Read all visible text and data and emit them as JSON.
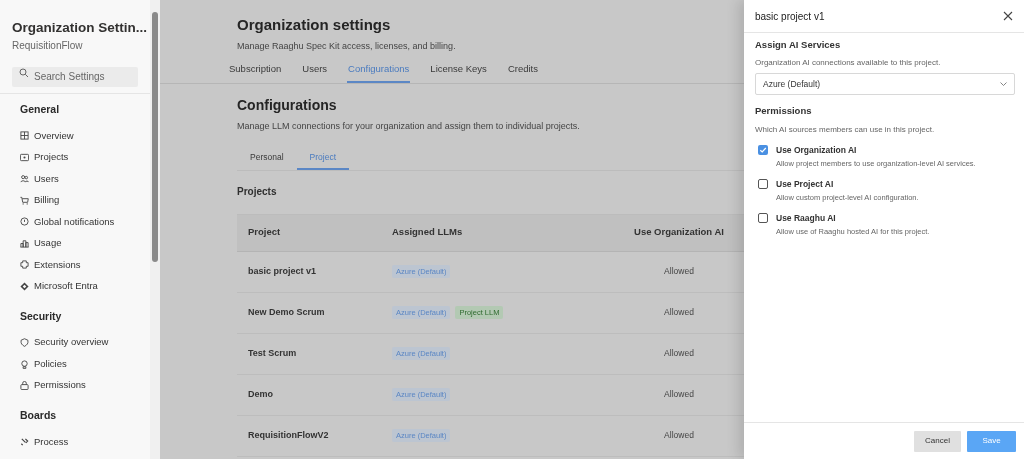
{
  "sidebar": {
    "title": "Organization Settin...",
    "subtitle": "RequisitionFlow",
    "search": {
      "placeholder": "Search Settings"
    },
    "sections": [
      {
        "heading": "General",
        "items": [
          {
            "label": "Overview"
          },
          {
            "label": "Projects"
          },
          {
            "label": "Users"
          },
          {
            "label": "Billing"
          },
          {
            "label": "Global notifications"
          },
          {
            "label": "Usage"
          },
          {
            "label": "Extensions"
          },
          {
            "label": "Microsoft Entra"
          }
        ]
      },
      {
        "heading": "Security",
        "items": [
          {
            "label": "Security overview"
          },
          {
            "label": "Policies"
          },
          {
            "label": "Permissions"
          }
        ]
      },
      {
        "heading": "Boards",
        "items": [
          {
            "label": "Process"
          }
        ]
      }
    ]
  },
  "main": {
    "title": "Organization settings",
    "subtitle": "Manage Raaghu Spec Kit access, licenses, and billing.",
    "tabs": [
      {
        "label": "Subscription",
        "selected": false
      },
      {
        "label": "Users",
        "selected": false
      },
      {
        "label": "Configurations",
        "selected": true
      },
      {
        "label": "License Keys",
        "selected": false
      },
      {
        "label": "Credits",
        "selected": false
      }
    ],
    "section_title": "Configurations",
    "section_subtitle": "Manage LLM connections for your organization and assign them to individual projects.",
    "subtabs": [
      {
        "label": "Personal",
        "selected": false
      },
      {
        "label": "Project",
        "selected": true
      }
    ],
    "table_title": "Projects",
    "table": {
      "columns": [
        "Project",
        "Assigned LLMs",
        "Use Organization AI"
      ],
      "rows": [
        {
          "project": "basic project v1",
          "llms": [
            {
              "label": "Azure (Default)",
              "kind": "default"
            }
          ],
          "org_ai": "Allowed"
        },
        {
          "project": "New Demo Scrum",
          "llms": [
            {
              "label": "Azure (Default)",
              "kind": "default"
            },
            {
              "label": "Project LLM",
              "kind": "project"
            }
          ],
          "org_ai": "Allowed"
        },
        {
          "project": "Test Scrum",
          "llms": [
            {
              "label": "Azure (Default)",
              "kind": "default"
            }
          ],
          "org_ai": "Allowed"
        },
        {
          "project": "Demo",
          "llms": [
            {
              "label": "Azure (Default)",
              "kind": "default"
            }
          ],
          "org_ai": "Allowed"
        },
        {
          "project": "RequisitionFlowV2",
          "llms": [
            {
              "label": "Azure (Default)",
              "kind": "default"
            }
          ],
          "org_ai": "Allowed"
        }
      ]
    }
  },
  "panel": {
    "title": "basic project v1",
    "assign_heading": "Assign AI Services",
    "assign_description": "Organization AI connections available to this project.",
    "select_value": "Azure (Default)",
    "permissions_heading": "Permissions",
    "permissions_description": "Which AI sources members can use in this project.",
    "options": [
      {
        "label": "Use Organization AI",
        "description": "Allow project members to use organization-level AI services.",
        "checked": true
      },
      {
        "label": "Use Project AI",
        "description": "Allow custom project-level AI configuration.",
        "checked": false
      },
      {
        "label": "Use Raaghu AI",
        "description": "Allow use of Raaghu hosted AI for this project.",
        "checked": false
      }
    ],
    "buttons": [
      {
        "label": "Cancel",
        "kind": "secondary"
      },
      {
        "label": "Save",
        "kind": "primary"
      }
    ]
  }
}
